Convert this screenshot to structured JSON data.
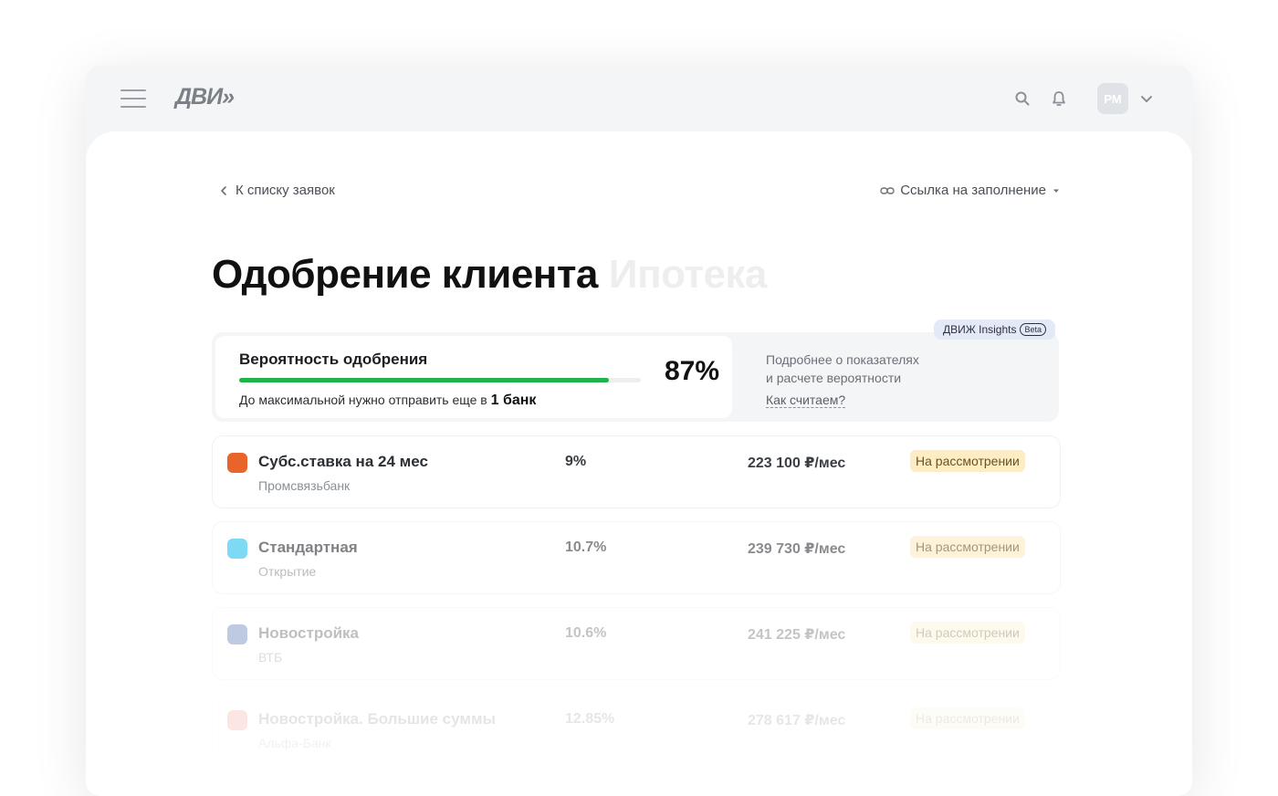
{
  "header": {
    "logo": "ДВИ»",
    "avatar_initials": "РМ"
  },
  "nav": {
    "back_label": "К списку заявок",
    "fill_link_label": "Ссылка на заполнение"
  },
  "page": {
    "title": "Одобрение клиента",
    "subtitle": "Ипотека"
  },
  "approval": {
    "label": "Вероятность одобрения",
    "percent_text": "87%",
    "progress": 0.92,
    "hint_prefix": "До максимальной нужно отправить еще в",
    "hint_value": "1 банк",
    "insights_badge": "ДВИЖ Insights",
    "beta": "Beta",
    "insights_line1": "Подробнее о показателях",
    "insights_line2": "и расчете вероятности",
    "insights_link": "Как считаем?"
  },
  "offers": [
    {
      "name": "Субс.ставка на 24 мес",
      "bank": "Промсвязьбанк",
      "rate": "9%",
      "payment": "223 100 ₽/мес",
      "status": "На рассмотрении",
      "logo_color": "#e8642a",
      "opacity": 1.0
    },
    {
      "name": "Стандартная",
      "bank": "Открытие",
      "rate": "10.7%",
      "payment": "239 730 ₽/мес",
      "status": "На рассмотрении",
      "logo_color": "#27c0ee",
      "opacity": 0.6
    },
    {
      "name": "Новостройка",
      "bank": "ВТБ",
      "rate": "10.6%",
      "payment": "241 225 ₽/мес",
      "status": "На рассмотрении",
      "logo_color": "#2b4ea2",
      "opacity": 0.3
    },
    {
      "name": "Новостройка. Большие суммы",
      "bank": "Альфа-Банк",
      "rate": "12.85%",
      "payment": "278 617 ₽/мес",
      "status": "На рассмотрении",
      "logo_color": "#ef3124",
      "opacity": 0.12
    }
  ],
  "colors": {
    "progress": "#20b34a",
    "status_bg": "#fdecc4",
    "insights_badge_bg": "#e4e9f7"
  }
}
